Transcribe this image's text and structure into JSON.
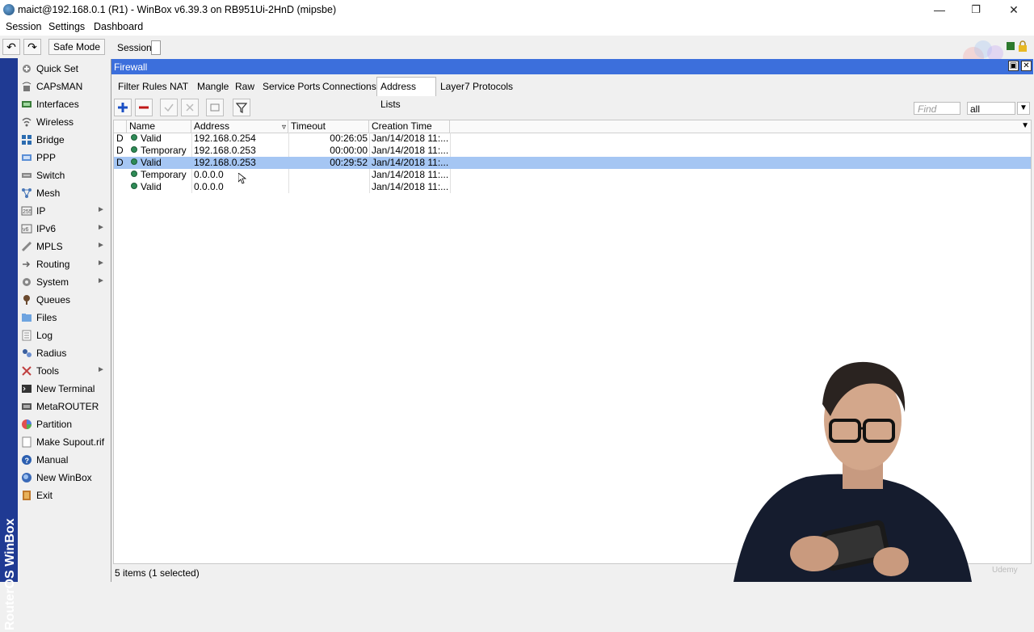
{
  "window": {
    "title": "maict@192.168.0.1 (R1) - WinBox v6.39.3 on RB951Ui-2HnD (mipsbe)",
    "min_glyph": "—",
    "restore_glyph": "❐",
    "close_glyph": "✕"
  },
  "menu": {
    "items": [
      "Session",
      "Settings",
      "Dashboard"
    ]
  },
  "toolbar": {
    "undo_glyph": "↶",
    "redo_glyph": "↷",
    "safe_mode": "Safe Mode",
    "session_label": "Session:"
  },
  "brand": {
    "vertical_text": "RouterOS WinBox"
  },
  "sidebar": {
    "items": [
      {
        "label": "Quick Set",
        "icon": "quick-set-icon"
      },
      {
        "label": "CAPsMAN",
        "icon": "capsman-icon"
      },
      {
        "label": "Interfaces",
        "icon": "interfaces-icon"
      },
      {
        "label": "Wireless",
        "icon": "wireless-icon"
      },
      {
        "label": "Bridge",
        "icon": "bridge-icon"
      },
      {
        "label": "PPP",
        "icon": "ppp-icon"
      },
      {
        "label": "Switch",
        "icon": "switch-icon"
      },
      {
        "label": "Mesh",
        "icon": "mesh-icon"
      },
      {
        "label": "IP",
        "icon": "ip-icon",
        "submenu": true
      },
      {
        "label": "IPv6",
        "icon": "ipv6-icon",
        "submenu": true
      },
      {
        "label": "MPLS",
        "icon": "mpls-icon",
        "submenu": true
      },
      {
        "label": "Routing",
        "icon": "routing-icon",
        "submenu": true
      },
      {
        "label": "System",
        "icon": "system-icon",
        "submenu": true
      },
      {
        "label": "Queues",
        "icon": "queues-icon"
      },
      {
        "label": "Files",
        "icon": "files-icon"
      },
      {
        "label": "Log",
        "icon": "log-icon"
      },
      {
        "label": "Radius",
        "icon": "radius-icon"
      },
      {
        "label": "Tools",
        "icon": "tools-icon",
        "submenu": true
      },
      {
        "label": "New Terminal",
        "icon": "terminal-icon"
      },
      {
        "label": "MetaROUTER",
        "icon": "metarouter-icon"
      },
      {
        "label": "Partition",
        "icon": "partition-icon"
      },
      {
        "label": "Make Supout.rif",
        "icon": "supout-icon"
      },
      {
        "label": "Manual",
        "icon": "manual-icon"
      },
      {
        "label": "New WinBox",
        "icon": "new-winbox-icon"
      },
      {
        "label": "Exit",
        "icon": "exit-icon"
      }
    ]
  },
  "firewall": {
    "title": "Firewall",
    "tabs": [
      "Filter Rules",
      "NAT",
      "Mangle",
      "Raw",
      "Service Ports",
      "Connections",
      "Address Lists",
      "Layer7 Protocols"
    ],
    "active_tab": "Address Lists",
    "find_placeholder": "Find",
    "filter_value": "all",
    "columns": [
      "Name",
      "Address",
      "Timeout",
      "Creation Time"
    ],
    "rows": [
      {
        "flag": "D",
        "name": "Valid",
        "address": "192.168.0.254",
        "timeout": "00:26:05",
        "created": "Jan/14/2018 11:...",
        "selected": false
      },
      {
        "flag": "D",
        "name": "Temporary",
        "address": "192.168.0.253",
        "timeout": "00:00:00",
        "created": "Jan/14/2018 11:...",
        "selected": false
      },
      {
        "flag": "D",
        "name": "Valid",
        "address": "192.168.0.253",
        "timeout": "00:29:52",
        "created": "Jan/14/2018 11:...",
        "selected": true
      },
      {
        "flag": "",
        "name": "Temporary",
        "address": "0.0.0.0",
        "timeout": "",
        "created": "Jan/14/2018 11:...",
        "selected": false
      },
      {
        "flag": "",
        "name": "Valid",
        "address": "0.0.0.0",
        "timeout": "",
        "created": "Jan/14/2018 11:...",
        "selected": false
      }
    ],
    "status": "5 items (1 selected)"
  },
  "overlay": {
    "watermark": "Udemy"
  }
}
